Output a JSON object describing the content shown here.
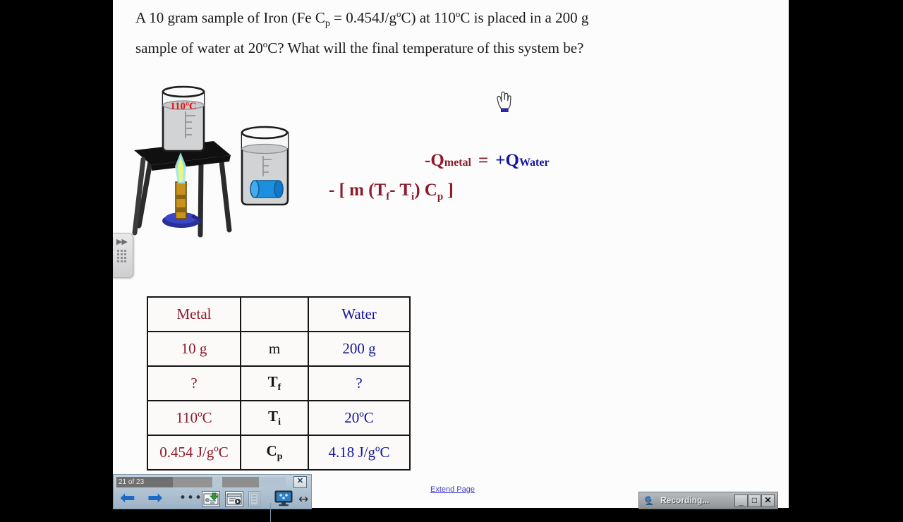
{
  "slide": {
    "question_line1_pre": "A 10 gram sample of Iron (Fe C",
    "question_sub1": "p",
    "question_line1_mid": " = 0.454J/g",
    "question_deg1": "o",
    "question_line1_mid2": "C) at 110",
    "question_deg2": "o",
    "question_line1_end": "C is placed in a 200 g",
    "question_line2_pre": "sample of water at 20",
    "question_deg3": "o",
    "question_line2_end": "C?  What will the final temperature of this system be?",
    "beaker_label": "110ºC"
  },
  "equation": {
    "left_sign_q": "-Q",
    "left_subscript": "metal",
    "equals": "=",
    "right_sign_q": "+Q",
    "right_subscript": "Water",
    "expanded_pre": "- [ m (T",
    "expanded_sub_f": "f",
    "expanded_minus": "- T",
    "expanded_sub_i": "i",
    "expanded_mid": ") C",
    "expanded_sub_p": "p",
    "expanded_end": " ]",
    "metal_color": "#8b1a2a",
    "water_color": "#14149c"
  },
  "table": {
    "rows": [
      {
        "metal": "Metal",
        "symbol": "",
        "water": "Water"
      },
      {
        "metal": "10 g",
        "symbol": "m",
        "water": "200 g"
      },
      {
        "metal": "?",
        "symbol": "T",
        "symbol_sub": "f",
        "water": "?"
      },
      {
        "metal": "110ºC",
        "symbol": "T",
        "symbol_sub": "i",
        "water": "20ºC"
      },
      {
        "metal": "0.454 J/gºC",
        "symbol": "C",
        "symbol_sub": "p",
        "water": "4.18 J/gºC"
      }
    ]
  },
  "links": {
    "extend_page": "Extend Page"
  },
  "player": {
    "slide_counter": "21 of 23",
    "close_label": "✕",
    "prev_label": "⬅",
    "next_label": "➡",
    "more_label": "•••",
    "icon_save": "save-icon",
    "icon_slideshow": "slideshow-icon",
    "icon_list": "list-icon",
    "icon_monitor": "monitor-icon",
    "icon_resize": "↔"
  },
  "recording_window": {
    "title": "Recording...",
    "minimize": "_",
    "maximize": "□",
    "close": "✕"
  },
  "sidetab": {
    "chevron": "▶▶"
  },
  "colors": {
    "stage_bg": "#fdfcfd",
    "letterbox": "#000000",
    "link_blue": "#3d3dbb",
    "maroon": "#8b1a2a",
    "navy": "#14149c"
  }
}
